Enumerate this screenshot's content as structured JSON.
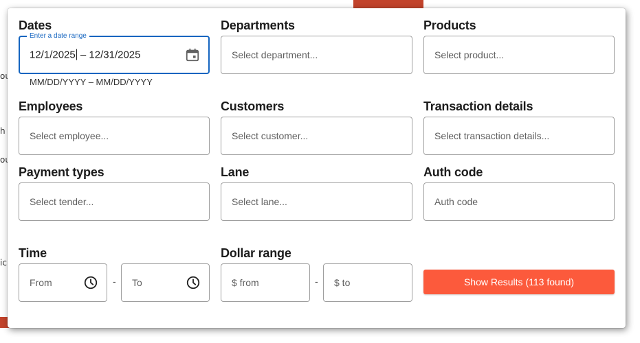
{
  "background": {
    "glyphs": [
      "ou",
      "h",
      "ou",
      "ic"
    ]
  },
  "filters": {
    "dates": {
      "label": "Dates",
      "floating_label": "Enter a date range",
      "start": "12/1/2025",
      "separator": "–",
      "end": "12/31/2025",
      "hint": "MM/DD/YYYY – MM/DD/YYYY"
    },
    "departments": {
      "label": "Departments",
      "placeholder": "Select department..."
    },
    "products": {
      "label": "Products",
      "placeholder": "Select product..."
    },
    "employees": {
      "label": "Employees",
      "placeholder": "Select employee..."
    },
    "customers": {
      "label": "Customers",
      "placeholder": "Select customer..."
    },
    "transaction_details": {
      "label": "Transaction details",
      "placeholder": "Select transaction details..."
    },
    "payment_types": {
      "label": "Payment types",
      "placeholder": "Select tender..."
    },
    "lane": {
      "label": "Lane",
      "placeholder": "Select lane..."
    },
    "auth_code": {
      "label": "Auth code",
      "placeholder": "Auth code"
    },
    "time": {
      "label": "Time",
      "from_placeholder": "From",
      "to_placeholder": "To",
      "separator": "-"
    },
    "dollar_range": {
      "label": "Dollar range",
      "from_placeholder": "$ from",
      "to_placeholder": "$ to",
      "separator": "-"
    }
  },
  "actions": {
    "show_results_label": "Show Results (113 found)"
  },
  "colors": {
    "accent_button": "#fc5a3c",
    "focus_blue": "#1565c0",
    "background_strip": "#c2432b"
  },
  "icons": {
    "date_picker": "calendar-icon",
    "time_picker": "clock-icon"
  }
}
